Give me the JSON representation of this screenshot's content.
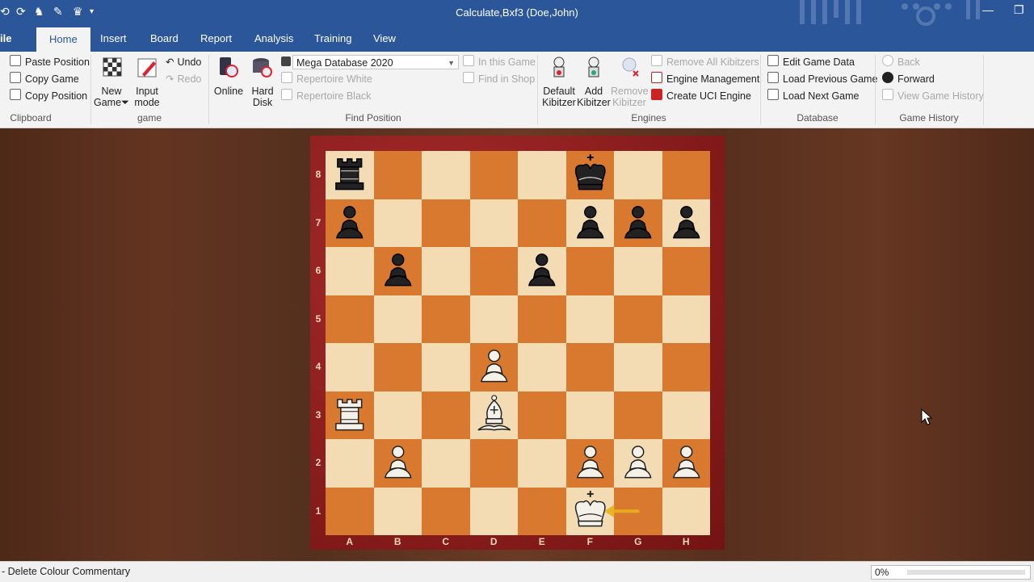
{
  "window": {
    "title": "Calculate,Bxf3  (Doe,John)"
  },
  "tabs": {
    "file": "ile",
    "home": "Home",
    "insert": "Insert",
    "board": "Board",
    "report": "Report",
    "analysis": "Analysis",
    "training": "Training",
    "view": "View"
  },
  "ribbon": {
    "clipboard": {
      "label": "Clipboard",
      "paste_position": "Paste Position",
      "copy_game": "Copy Game",
      "copy_position": "Copy Position"
    },
    "game": {
      "label": "game",
      "new_game": "New Game",
      "input_mode_1": "Input",
      "input_mode_2": "mode",
      "undo": "Undo",
      "redo": "Redo",
      "new_game_1": "New",
      "new_game_2": "Game"
    },
    "find_position": {
      "label": "Find Position",
      "online": "Online",
      "hard_disk_1": "Hard",
      "hard_disk_2": "Disk",
      "database_value": "Mega Database 2020",
      "repertoire_white": "Repertoire White",
      "repertoire_black": "Repertoire Black",
      "in_this_game": "In this Game",
      "find_in_shop": "Find in Shop"
    },
    "engines": {
      "label": "Engines",
      "default_kibitzer_1": "Default",
      "default_kibitzer_2": "Kibitzer",
      "add_kibitzer_1": "Add",
      "add_kibitzer_2": "Kibitzer",
      "remove_kibitzer_1": "Remove",
      "remove_kibitzer_2": "Kibitzer",
      "remove_all_kibitzers": "Remove All Kibitzers",
      "engine_management": "Engine Management",
      "create_uci_engine": "Create UCI Engine"
    },
    "database": {
      "label": "Database",
      "edit_game_data": "Edit Game Data",
      "load_previous_game": "Load Previous Game",
      "load_next_game": "Load Next Game"
    },
    "game_history": {
      "label": "Game History",
      "back": "Back",
      "forward": "Forward",
      "view_game_history": "View Game History"
    }
  },
  "board": {
    "files": [
      "A",
      "B",
      "C",
      "D",
      "E",
      "F",
      "G",
      "H"
    ],
    "ranks": [
      "8",
      "7",
      "6",
      "5",
      "4",
      "3",
      "2",
      "1"
    ],
    "pieces": [
      {
        "square": "a8",
        "piece": "black-rook"
      },
      {
        "square": "f8",
        "piece": "black-king"
      },
      {
        "square": "a7",
        "piece": "black-pawn"
      },
      {
        "square": "f7",
        "piece": "black-pawn"
      },
      {
        "square": "g7",
        "piece": "black-pawn"
      },
      {
        "square": "h7",
        "piece": "black-pawn"
      },
      {
        "square": "b6",
        "piece": "black-pawn"
      },
      {
        "square": "e6",
        "piece": "black-pawn"
      },
      {
        "square": "d4",
        "piece": "white-pawn"
      },
      {
        "square": "a3",
        "piece": "white-rook"
      },
      {
        "square": "d3",
        "piece": "white-bishop"
      },
      {
        "square": "b2",
        "piece": "white-pawn"
      },
      {
        "square": "f2",
        "piece": "white-pawn"
      },
      {
        "square": "g2",
        "piece": "white-pawn"
      },
      {
        "square": "h2",
        "piece": "white-pawn"
      },
      {
        "square": "f1",
        "piece": "white-king"
      }
    ],
    "arrow": {
      "from": "g1",
      "to": "f1",
      "color": "#e8b21a"
    }
  },
  "status": {
    "text": "- Delete Colour Commentary",
    "progress": "0%"
  }
}
